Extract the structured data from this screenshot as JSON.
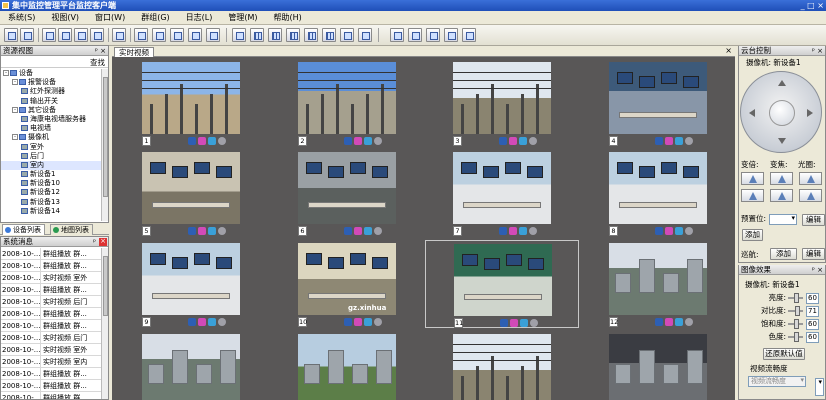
{
  "window": {
    "title": "集中监控管理平台监控客户端",
    "controls": "_ □ ×"
  },
  "menu": [
    "系统(S)",
    "视图(V)",
    "窗口(W)",
    "群组(G)",
    "日志(L)",
    "管理(M)",
    "帮助(H)"
  ],
  "resource_panel": {
    "title": "资源视图",
    "search_label": "查找",
    "tree": [
      {
        "label": "设备",
        "level": 0,
        "expander": "-"
      },
      {
        "label": "报警设备",
        "level": 1,
        "expander": "-"
      },
      {
        "label": "红外探测器",
        "level": 2,
        "expander": ""
      },
      {
        "label": "输出开关",
        "level": 2,
        "expander": ""
      },
      {
        "label": "其它设备",
        "level": 1,
        "expander": "-"
      },
      {
        "label": "海康电视墙服务器",
        "level": 2,
        "expander": ""
      },
      {
        "label": "电视墙",
        "level": 2,
        "expander": ""
      },
      {
        "label": "摄像机",
        "level": 1,
        "expander": "-"
      },
      {
        "label": "室外",
        "level": 2,
        "expander": ""
      },
      {
        "label": "后门",
        "level": 2,
        "expander": ""
      },
      {
        "label": "室内",
        "level": 2,
        "expander": "",
        "selected": true
      },
      {
        "label": "新设备1",
        "level": 2,
        "expander": ""
      },
      {
        "label": "新设备10",
        "level": 2,
        "expander": ""
      },
      {
        "label": "新设备12",
        "level": 2,
        "expander": ""
      },
      {
        "label": "新设备13",
        "level": 2,
        "expander": ""
      },
      {
        "label": "新设备14",
        "level": 2,
        "expander": ""
      }
    ]
  },
  "left_tabs": {
    "devices": "设备列表",
    "map": "地图列表"
  },
  "message_panel": {
    "title": "系统消息",
    "rows": [
      [
        "2008-10-...",
        "群组播放 群..."
      ],
      [
        "2008-10-...",
        "群组播放 群..."
      ],
      [
        "2008-10-...",
        "实时视频 室外"
      ],
      [
        "2008-10-...",
        "群组播放 群..."
      ],
      [
        "2008-10-...",
        "实时视频 后门"
      ],
      [
        "2008-10-...",
        "群组播放 群..."
      ],
      [
        "2008-10-...",
        "群组播放 群..."
      ],
      [
        "2008-10-...",
        "实时视频 后门"
      ],
      [
        "2008-10-...",
        "实时视频 室外"
      ],
      [
        "2008-10-...",
        "实时视频 室内"
      ],
      [
        "2008-10-...",
        "群组播放 群..."
      ],
      [
        "2008-10-...",
        "群组播放 群..."
      ],
      [
        "2008-10-...",
        "群组播放 群..."
      ]
    ]
  },
  "center": {
    "tab_label": "实时视频",
    "cells": [
      {
        "num": "1",
        "scene": "sky1"
      },
      {
        "num": "2",
        "scene": "sky2"
      },
      {
        "num": "3",
        "scene": "sky3"
      },
      {
        "num": "4",
        "scene": "room4"
      },
      {
        "num": "5",
        "scene": "room1"
      },
      {
        "num": "6",
        "scene": "room2"
      },
      {
        "num": "7",
        "scene": "room3"
      },
      {
        "num": "8",
        "scene": "room3"
      },
      {
        "num": "9",
        "scene": "room3"
      },
      {
        "num": "10",
        "scene": "room5",
        "watermark": "gz.xinhua"
      },
      {
        "num": "11",
        "scene": "room6",
        "selected": true
      },
      {
        "num": "12",
        "scene": "city"
      },
      {
        "num": "",
        "scene": "city"
      },
      {
        "num": "",
        "scene": "city2"
      },
      {
        "num": "",
        "scene": "sky3"
      },
      {
        "num": "",
        "scene": "dark"
      }
    ]
  },
  "ptz": {
    "title": "云台控制",
    "camera": "摄像机: 新设备1",
    "zoom": "变倍:",
    "focus": "变焦:",
    "iris": "光圈:",
    "preset_label": "预置位:",
    "add": "添加",
    "edit": "编辑",
    "tour_label": "巡航:"
  },
  "image_effects": {
    "title": "图像效果",
    "camera": "摄像机: 新设备1",
    "sliders": [
      {
        "label": "亮度:",
        "value": "60",
        "level": 0.6
      },
      {
        "label": "对比度:",
        "value": "71",
        "level": 0.71
      },
      {
        "label": "饱和度:",
        "value": "60",
        "level": 0.6
      },
      {
        "label": "色度:",
        "value": "60",
        "level": 0.6
      }
    ],
    "restore": "还原默认值",
    "stream_label": "视频流畅度",
    "stream_value": "视频流畅度"
  }
}
